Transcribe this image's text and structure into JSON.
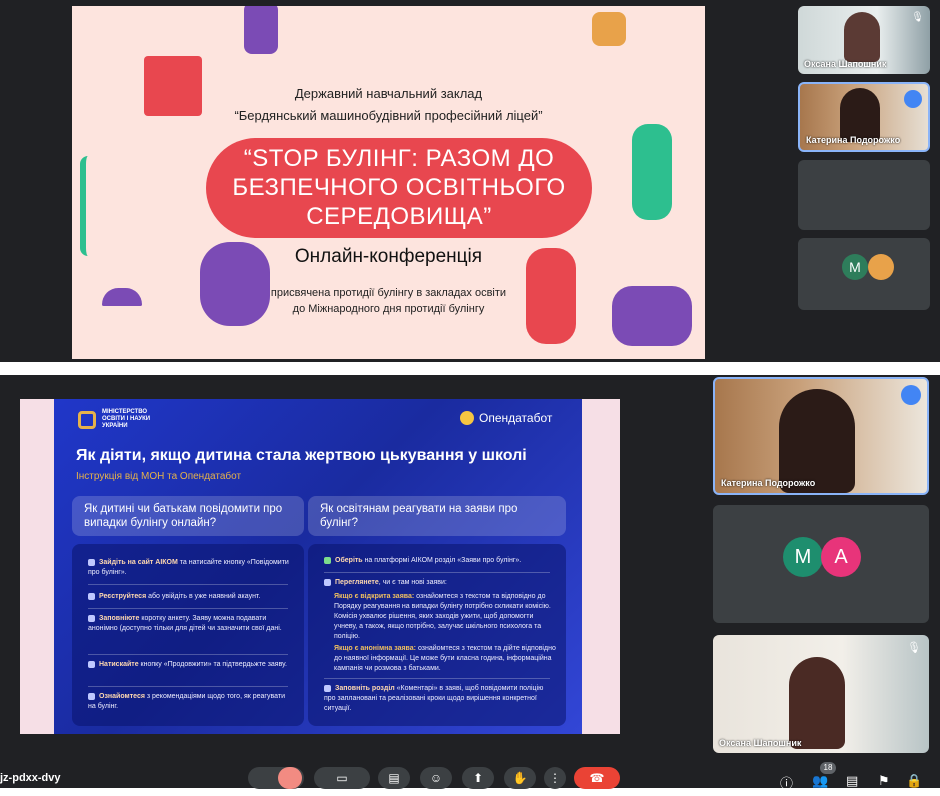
{
  "top_slide": {
    "institution_line1": "Державний навчальний заклад",
    "institution_line2": "“Бердянський машинобудівний професійний ліцей”",
    "headline_1": "“STOP БУЛІНГ: РАЗОМ ДО",
    "headline_2": "БЕЗПЕЧНОГО ОСВІТНЬОГО",
    "headline_3": "СЕРЕДОВИЩА”",
    "conference": "Онлайн-конференція",
    "dedication_1": "присвячена протидії булінгу в закладах освіти",
    "dedication_2": "до Міжнародного дня протидії булінгу"
  },
  "top_tiles": [
    {
      "name": "Оксана Шапошник"
    },
    {
      "name": "Катерина Подорожко"
    },
    {
      "avatars": [
        "M"
      ]
    }
  ],
  "bottom_slide": {
    "ministry": [
      "МІНІСТЕРСТВО",
      "ОСВІТИ І НАУКИ",
      "УКРАЇНИ"
    ],
    "partner": "Опендатабот",
    "title": "Як діяти, якщо дитина стала жертвою цькування у школі",
    "subtitle": "Інструкція від МОН та Опендатабот",
    "q_left": "Як дитині чи батькам повідомити про випадки булінгу онлайн?",
    "q_right": "Як освітянам реагувати на заяви про булінг?",
    "left_items": [
      {
        "b": "Зайдіть на сайт АІКОМ",
        "t": " та натисайте кнопку «Повідомити про булінг»."
      },
      {
        "b": "Реєструйтеся",
        "t": " або увійдіть в уже наявний акаунт."
      },
      {
        "b": "Заповніюте",
        "t": " коротку анкету. Заяву можна подавати анонімно (доступно тільки для дітей чи зазначити свої дані."
      },
      {
        "b": "Натискайте",
        "t": " кнопку «Продовжити» та підтвердьжте заяву."
      },
      {
        "b": "Ознайомтеся",
        "t": " з рекомендаціями щодо того, як реагувати на булінг."
      }
    ],
    "right_items": [
      {
        "b": "Оберіть",
        "t": " на платформі АІКОМ розділ «Заяви про булінг»."
      },
      {
        "b": "Переглянете",
        "t": ", чи є там нові заяви:"
      },
      {
        "b": "Якщо є відкрита заява:",
        "t": " ознайомтеся з текстом та відповідно до Порядку реагування на випадки булінгу потрібно скликати комісію. Комісія ухвалює рішення, яких заходів ужити, щоб допомогти учневу, а також, якщо потрібно, залучає шкільного психолога та поліцію."
      },
      {
        "b": "Якщо є анонімна заява:",
        "t": " ознайомтеся з текстом та дійте відповідно до наявної інформації. Це може бути класна година, інформаційна кампанія чи розмова з батьками."
      },
      {
        "b": "Заповніть розділ",
        "t": " «Коментарі» в заяві, щоб повідомити поліцію про заплановані та реалізовані кроки щодо вирішення конкретної ситуації."
      }
    ]
  },
  "bottom_tiles": [
    {
      "name": "Катерина Подорожко"
    },
    {
      "avatars": [
        "M",
        "A"
      ]
    },
    {
      "name": "Оксана Шапошник"
    }
  ],
  "meeting": {
    "code": "jz-pdxx-dvy",
    "participants": "18"
  },
  "colors": {
    "accent_red": "#e8474f",
    "slide_blue": "#1f2fa8",
    "meet_dark": "#202124",
    "end_call": "#ea4335"
  }
}
